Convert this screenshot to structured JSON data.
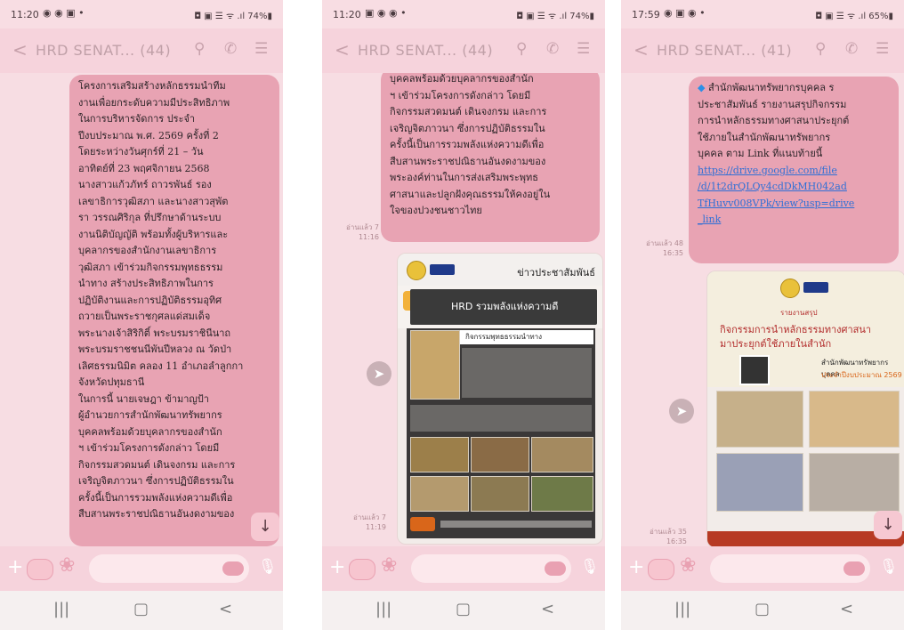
{
  "icons": {
    "back": "chevron-left-icon",
    "search": "search-icon",
    "call": "phone-icon",
    "menu": "menu-icon",
    "share": "share-icon",
    "scroll": "arrow-down-icon",
    "plus": "plus-icon",
    "mic": "microphone-icon"
  },
  "colors": {
    "bubble": "#e8a3b3",
    "background": "#f7dde3",
    "link": "#2f6fd6"
  },
  "screens": [
    {
      "status": {
        "time": "11:20",
        "indicators": "◉ ◉ ▣ •",
        "right": "◘ ▣ ☰ ᯤ .ıl 74%▮"
      },
      "header": {
        "back": "<",
        "title": "HRD SENAT... (44)"
      },
      "bubble_lines": [
        "โครงการเสริมสร้างหลักธรรมนำทีม",
        "งานเพื่อยกระดับความมีประสิทธิภาพ",
        "ในการบริหารจัดการ ประจำ",
        "ปีงบประมาณ พ.ศ. 2569 ครั้งที่ 2",
        "     โดยระหว่างวันศุกร์ที่ 21 – วัน",
        "อาทิตย์ที่ 23 พฤศจิกายน 2568",
        "นางสาวแก้วภัทร์ ถาวรพันธ์ รอง",
        "เลขาธิการวุฒิสภา และนางสาวสุพัต",
        "รา วรรณศิริกุล ที่ปรึกษาด้านระบบ",
        "งานนิติบัญญัติ พร้อมทั้งผู้บริหารและ",
        "บุคลากรของสำนักงานเลขาธิการ",
        "วุฒิสภา เข้าร่วมกิจกรรมพุทธธรรม",
        "นำทาง สร้างประสิทธิภาพในการ",
        "ปฏิบัติงานและการปฏิบัติธรรมอุทิศ",
        "ถวายเป็นพระราชกุศลแด่สมเด็จ",
        "พระนางเจ้าสิริกิติ์ พระบรมราชินีนาถ",
        "พระบรมราชชนนีพันปีหลวง ณ วัดป่า",
        "เลิศธรรมนิมิต คลอง 11 อำเภอลำลูกกา",
        "จังหวัดปทุมธานี",
        "     ในการนี้ นายเจษฎา ข้ามาญป้า",
        "ผู้อำนวยการสำนักพัฒนาทรัพยากร",
        "บุคคลพร้อมด้วยบุคลากรของสำนัก",
        "ฯ เข้าร่วมโครงการดังกล่าว โดยมี",
        "กิจกรรมสวดมนต์ เดินจงกรม และการ",
        "เจริญจิตภาวนา ซึ่งการปฏิบัติธรรมใน",
        "ครั้งนี้เป็นการรวมพลังแห่งความดีเพื่อ",
        "สืบสานพระราชปณิธานอันงดงามของ"
      ],
      "composer": {
        "plus": "+"
      },
      "nav": {
        "recent": "|||",
        "home": "▢",
        "back": "<"
      }
    },
    {
      "status": {
        "time": "11:20",
        "indicators": "▣ ◉ ◉ •",
        "right": "◘ ▣ ☰ ᯤ .ıl 74%▮"
      },
      "header": {
        "back": "<",
        "title": "HRD SENAT... (44)"
      },
      "bubble_lines": [
        "บุคคลพร้อมด้วยบุคลากรของสำนัก",
        "ฯ เข้าร่วมโครงการดังกล่าว โดยมี",
        "กิจกรรมสวดมนต์ เดินจงกรม และการ",
        "เจริญจิตภาวนา ซึ่งการปฏิบัติธรรมใน",
        "ครั้งนี้เป็นการรวมพลังแห่งความดีเพื่อ",
        "สืบสานพระราชปณิธานอันงดงามของ",
        "พระองค์ท่านในการส่งเสริมพระพุทธ",
        "ศาสนาและปลูกฝังคุณธรรมให้คงอยู่ใน",
        "ใจของปวงชนชาวไทย"
      ],
      "meta1": {
        "read": "อ่านแล้ว 7",
        "time": "11:16"
      },
      "card": {
        "news_label": "ข่าวประชาสัมพันธ์",
        "headline": "HRD รวมพลังแห่งความดี",
        "subheading": "กิจกรรมพุทธธรรมนำทาง"
      },
      "meta2": {
        "read": "อ่านแล้ว 7",
        "time": "11:19"
      },
      "composer": {
        "plus": "+"
      },
      "nav": {
        "recent": "|||",
        "home": "▢",
        "back": "<"
      }
    },
    {
      "status": {
        "time": "17:59",
        "indicators": "◉ ▣ ◉ •",
        "right": "◘ ▣ ☰ ᯤ .ıl 65%▮"
      },
      "header": {
        "back": "<",
        "title": "HRD SENAT... (41)"
      },
      "bubble": {
        "diamond": "◆",
        "text_lines": [
          " สำนักพัฒนาทรัพยากรบุคคล ร",
          "ประชาสัมพันธ์ รายงานสรุปกิจกรรม",
          "การนำหลักธรรมทางศาสนาประยุกต์",
          "ใช้ภายในสำนักพัฒนาทรัพยากร",
          "บุคคล ตาม Link ที่แนบท้ายนี้"
        ],
        "link_lines": [
          "https://drive.google.com/file",
          "/d/1t2drQLQy4cdDkMH042ad",
          "TfHuvv008VPk/view?usp=drive",
          "_link"
        ]
      },
      "meta1": {
        "read": "อ่านแล้ว 48",
        "time": "16:35"
      },
      "card": {
        "keyword": "รายงานสรุป",
        "title_line1": "กิจกรรมการนำหลักธรรมทางศาสนา",
        "title_line2": "มาประยุกต์ใช้ภายในสำนัก",
        "org": "สำนักพัฒนาทรัพยากรบุคคล",
        "year": "ประจำปีงบประมาณ 2569"
      },
      "meta2": {
        "read": "อ่านแล้ว 35",
        "time": "16:35"
      },
      "composer": {
        "plus": "+"
      },
      "nav": {
        "recent": "|||",
        "home": "▢",
        "back": "<"
      }
    }
  ]
}
